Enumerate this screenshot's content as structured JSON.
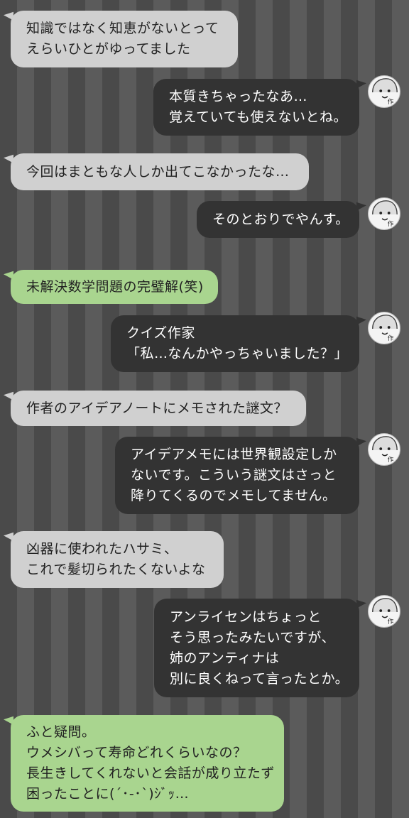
{
  "messages": [
    {
      "side": "left",
      "lines": [
        "知識ではなく知恵がないとって",
        "えらいひとがゆってました"
      ]
    },
    {
      "side": "right",
      "avatar": "author-face-icon",
      "lines": [
        "本質きちゃったなあ…",
        "覚えていても使えないとね。"
      ]
    },
    {
      "side": "left",
      "lines": [
        "今回はまともな人しか出てこなかったな…"
      ]
    },
    {
      "side": "right",
      "avatar": "author-face-icon",
      "lines": [
        "そのとおりでやんす。"
      ]
    },
    {
      "side": "left",
      "style": "green",
      "lines": [
        "未解決数学問題の完璧解(笑)"
      ]
    },
    {
      "side": "right",
      "avatar": "author-face-icon",
      "lines": [
        "クイズ作家",
        "「私…なんかやっちゃいました？」"
      ]
    },
    {
      "side": "left",
      "lines": [
        "作者のアイデアノートにメモされた謎文？"
      ]
    },
    {
      "side": "right",
      "avatar": "author-face-icon",
      "lines": [
        "アイデアメモには世界観設定しか",
        "ないです。こういう謎文はさっと",
        "降りてくるのでメモしてません。"
      ]
    },
    {
      "side": "left",
      "lines": [
        "凶器に使われたハサミ、",
        "これで髪切られたくないよな"
      ]
    },
    {
      "side": "right",
      "avatar": "author-face-icon",
      "lines": [
        "アンライセンはちょっと",
        "そう思ったみたいですが、",
        "姉のアンティナは",
        "別に良くねって言ったとか。"
      ]
    },
    {
      "side": "left",
      "style": "green",
      "lines": [
        "ふと疑問。",
        "ウメシバって寿命どれくらいなの？",
        "長生きしてくれないと会話が成り立たず",
        "困ったことに(´･-･`)ｼﾞｯ…"
      ]
    }
  ],
  "avatar_label": "作",
  "colors": {
    "left_bubble": "#d0d0d0",
    "left_bubble_green": "#a9d58f",
    "right_bubble": "#333333",
    "stripe_dark": "#4a4a4a",
    "stripe_light": "#5b5b5b"
  }
}
